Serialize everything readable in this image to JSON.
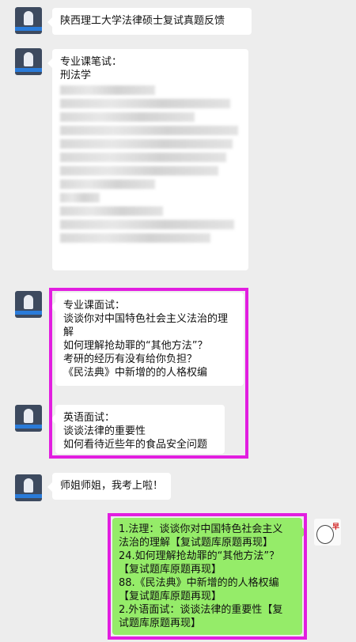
{
  "messages": [
    {
      "text": "陕西理工大学法律硕士复试真题反馈"
    },
    {
      "lines": [
        "专业课笔试：",
        "刑法学"
      ]
    },
    {
      "lines": [
        "专业课面试：",
        "谈谈你对中国特色社会主义法治的理",
        "解",
        "如何理解抢劫罪的“其他方法”？",
        "考研的经历有没有给你负担？",
        "《民法典》中新增的的人格权编"
      ]
    },
    {
      "lines": [
        "英语面试：",
        "谈谈法律的重要性",
        "如何看待近些年的食品安全问题"
      ]
    },
    {
      "text": "师姐师姐，我考上啦！"
    },
    {
      "lines": [
        "1.法理：谈谈你对中国特色社会主义",
        "法治的理解【复试题库原题再现】",
        "24.如何理解抢劫罪的“其他方法”？",
        "【复试题库原题再现】",
        "88.《民法典》中新增的的人格权编",
        "【复试题库原题再现】",
        "2.外语面试：谈谈法律的重要性【复",
        "试题库原题再现】"
      ]
    }
  ],
  "right_avatar_tag": "早"
}
